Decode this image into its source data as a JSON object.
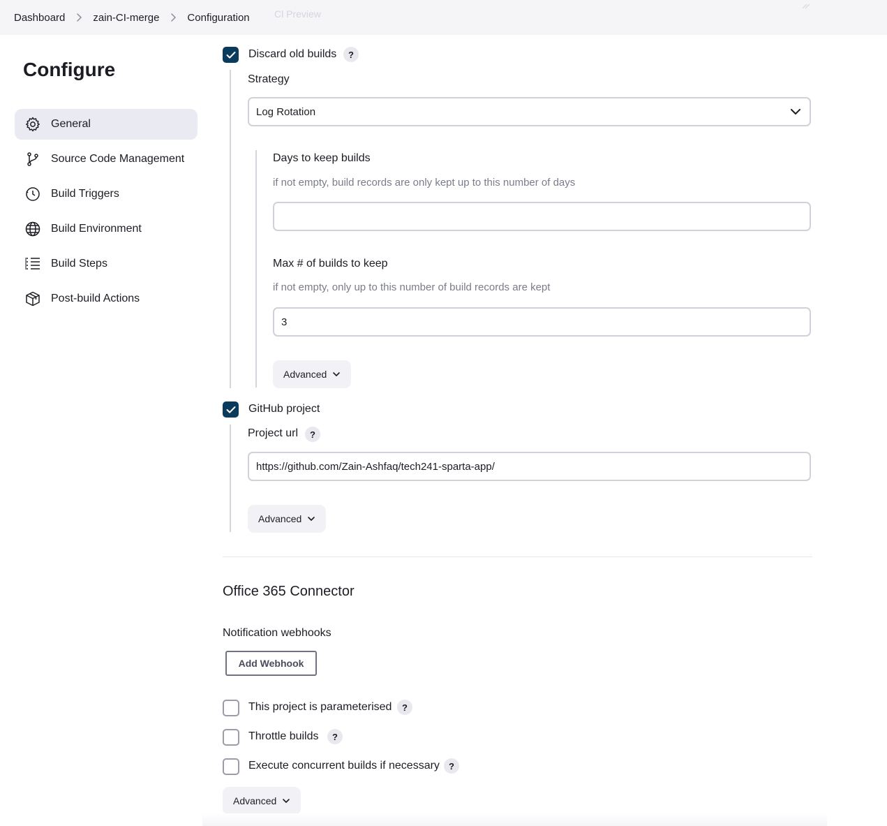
{
  "breadcrumb": {
    "items": [
      "Dashboard",
      "zain-CI-merge",
      "Configuration"
    ],
    "ghost_text": "Cl Preview"
  },
  "sidebar": {
    "title": "Configure",
    "items": [
      {
        "label": "General",
        "icon": "gear-icon",
        "active": true
      },
      {
        "label": "Source Code Management",
        "icon": "branch-icon"
      },
      {
        "label": "Build Triggers",
        "icon": "clock-icon"
      },
      {
        "label": "Build Environment",
        "icon": "globe-icon"
      },
      {
        "label": "Build Steps",
        "icon": "list-icon"
      },
      {
        "label": "Post-build Actions",
        "icon": "package-icon"
      }
    ]
  },
  "general": {
    "discard_old_builds": {
      "label": "Discard old builds",
      "checked": true,
      "help": "?",
      "strategy_label": "Strategy",
      "strategy_value": "Log Rotation",
      "days_label": "Days to keep builds",
      "days_desc": "if not empty, build records are only kept up to this number of days",
      "days_value": "",
      "max_label": "Max # of builds to keep",
      "max_desc": "if not empty, only up to this number of build records are kept",
      "max_value": "3",
      "advanced_label": "Advanced"
    },
    "github_project": {
      "label": "GitHub project",
      "checked": true,
      "url_label": "Project url",
      "help": "?",
      "url_value": "https://github.com/Zain-Ashfaq/tech241-sparta-app/",
      "advanced_label": "Advanced"
    },
    "office365": {
      "title": "Office 365 Connector",
      "webhooks_label": "Notification webhooks",
      "add_webhook_label": "Add Webhook"
    },
    "options": [
      {
        "label": "This project is parameterised",
        "checked": false,
        "help": "?"
      },
      {
        "label": "Throttle builds",
        "checked": false,
        "help": "?"
      },
      {
        "label": "Execute concurrent builds if necessary",
        "checked": false,
        "help": "?"
      }
    ],
    "advanced_label": "Advanced"
  },
  "colors": {
    "checkbox_checked": "#0b3b5c",
    "active_nav_bg": "#eaeaf2",
    "topbar_bg": "#f5f5f8"
  }
}
